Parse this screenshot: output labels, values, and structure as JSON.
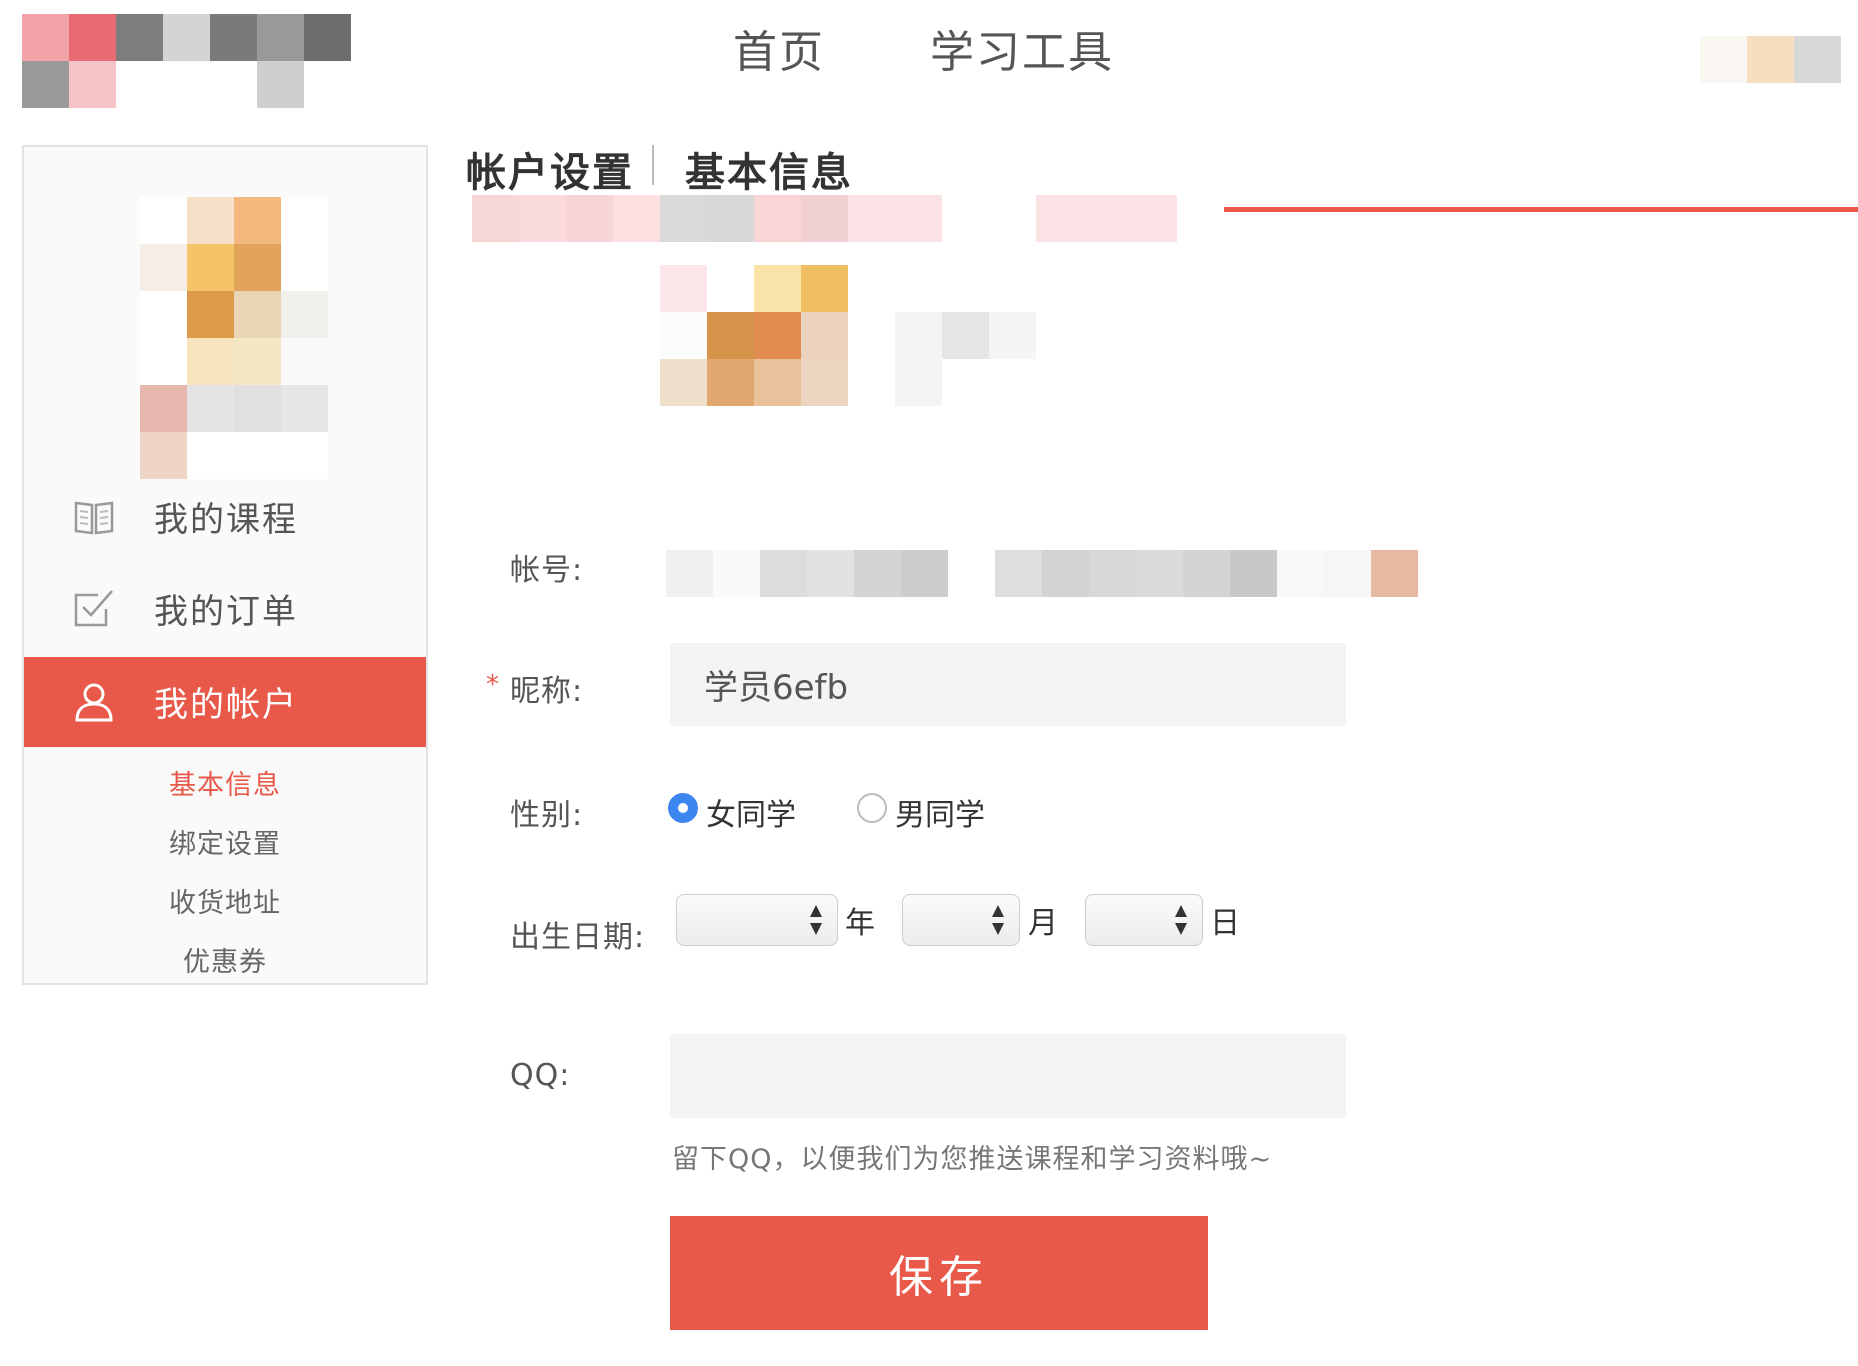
{
  "nav": {
    "home": "首页",
    "tools": "学习工具"
  },
  "sidebar": {
    "items": [
      {
        "label": "我的课程",
        "icon": "book-icon"
      },
      {
        "label": "我的订单",
        "icon": "checkbox-icon"
      },
      {
        "label": "我的帐户",
        "icon": "user-icon",
        "active": true
      }
    ],
    "sub_items": [
      {
        "label": "基本信息",
        "active": true
      },
      {
        "label": "绑定设置"
      },
      {
        "label": "收货地址"
      },
      {
        "label": "优惠券"
      }
    ]
  },
  "header": {
    "section": "帐户设置",
    "page": "基本信息"
  },
  "form": {
    "account_label": "帐号:",
    "nickname_label": "昵称:",
    "required_mark": "*",
    "nickname_value": "学员6efb",
    "gender_label": "性别:",
    "gender_female": "女同学",
    "gender_male": "男同学",
    "gender_selected": "女同学",
    "birthday_label": "出生日期:",
    "year_unit": "年",
    "month_unit": "月",
    "day_unit": "日",
    "qq_label": "QQ:",
    "qq_value": "",
    "qq_hint": "留下QQ，以便我们为您推送课程和学习资料哦~",
    "save_label": "保存"
  },
  "colors": {
    "accent": "#e8594a",
    "radio_selected": "#3d86f0",
    "input_bg": "#f3f4f6"
  }
}
